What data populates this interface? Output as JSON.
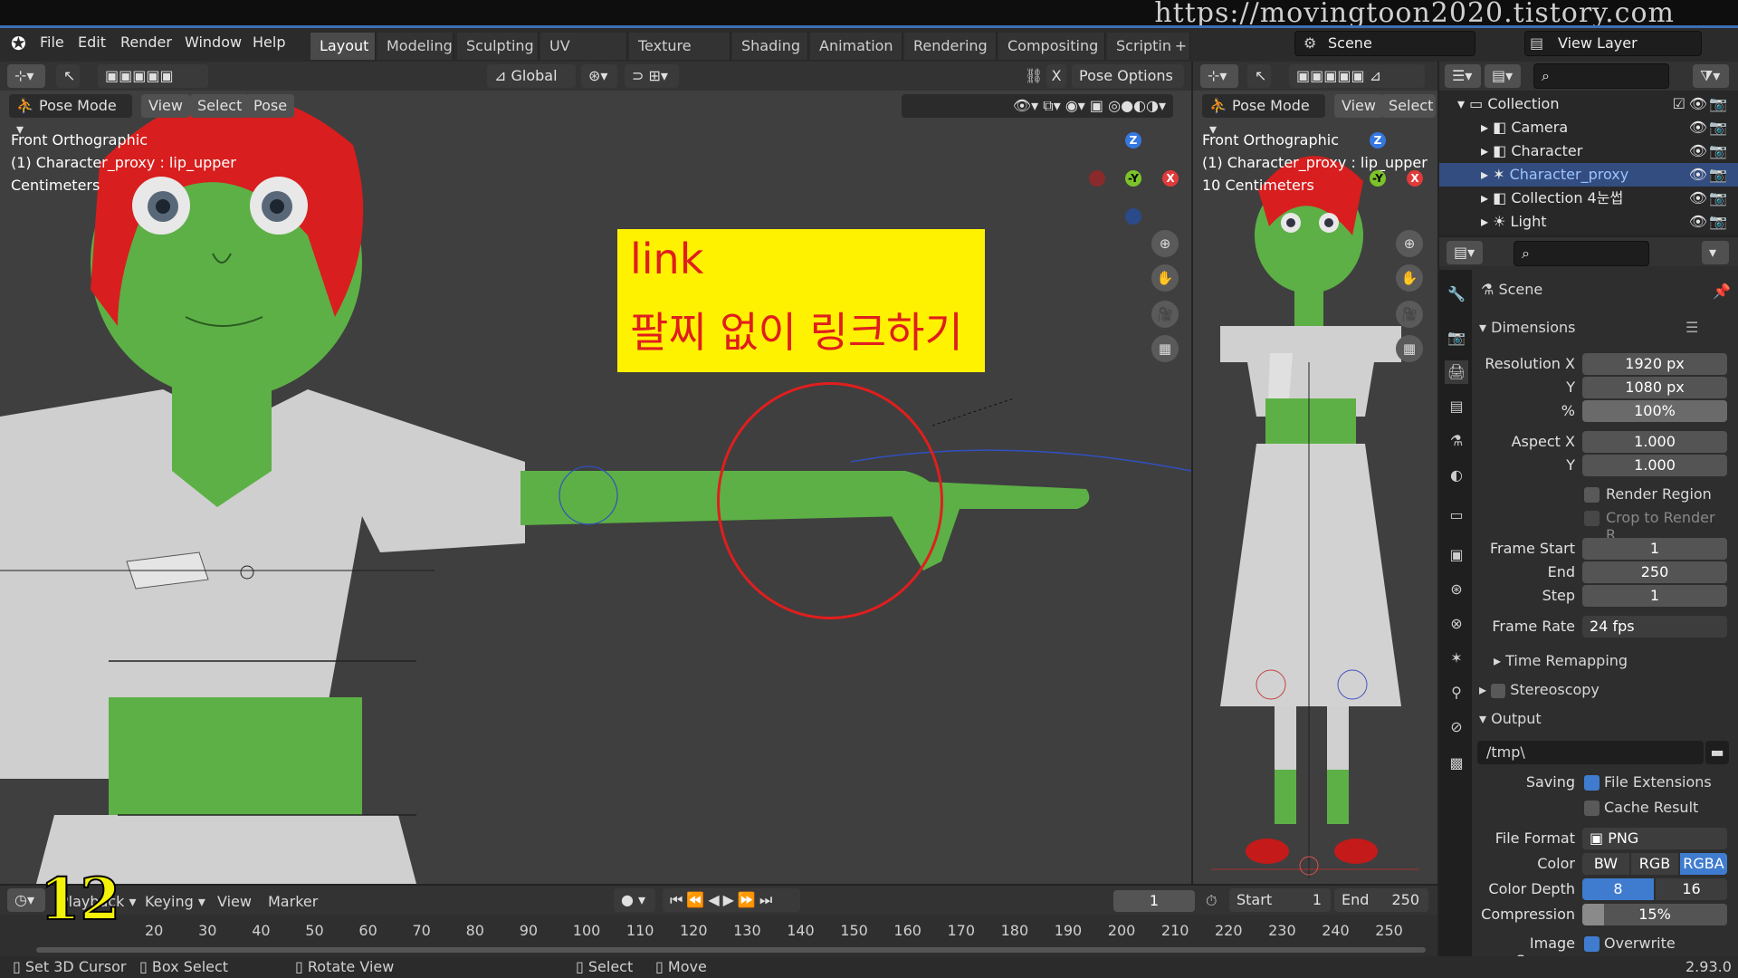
{
  "url_watermark": "https://movingtoon2020.tistory.com",
  "menus": [
    "File",
    "Edit",
    "Render",
    "Window",
    "Help"
  ],
  "workspaces": [
    "Layout",
    "Modeling",
    "Sculpting",
    "UV Editing",
    "Texture Paint",
    "Shading",
    "Animation",
    "Rendering",
    "Compositing",
    "Scripting"
  ],
  "active_workspace": "Layout",
  "scene_name": "Scene",
  "view_layer": "View Layer",
  "viewport_left": {
    "mode": "Pose Mode",
    "header_buttons": [
      "View",
      "Select",
      "Pose"
    ],
    "transform_orientation": "Global",
    "pose_options": "Pose Options",
    "overlay_lines": [
      "Front Orthographic",
      "(1) Character_proxy : lip_upper",
      "Centimeters"
    ]
  },
  "viewport_right": {
    "mode": "Pose Mode",
    "header_buttons": [
      "View",
      "Select"
    ],
    "overlay_lines": [
      "Front Orthographic",
      "(1) Character_proxy : lip_upper",
      "10 Centimeters"
    ]
  },
  "gizmo": {
    "z": "Z",
    "y": "-Y",
    "x": "X"
  },
  "annotation": {
    "line1": "link",
    "line2": "팔찌 없이 링크하기"
  },
  "outliner": {
    "root": "Collection",
    "items": [
      "Camera",
      "Character",
      "Character_proxy",
      "Collection 4눈썹",
      "Light"
    ],
    "selected": "Character_proxy"
  },
  "properties": {
    "context": "Scene",
    "dimensions_header": "Dimensions",
    "resolution_x_label": "Resolution X",
    "resolution_x": "1920 px",
    "resolution_y_label": "Y",
    "resolution_y": "1080 px",
    "percent_label": "%",
    "percent": "100%",
    "aspect_x_label": "Aspect X",
    "aspect_x": "1.000",
    "aspect_y_label": "Y",
    "aspect_y": "1.000",
    "render_region": "Render Region",
    "crop_region": "Crop to Render R...",
    "frame_start_label": "Frame Start",
    "frame_start": "1",
    "end_label": "End",
    "frame_end": "250",
    "step_label": "Step",
    "frame_step": "1",
    "frame_rate_label": "Frame Rate",
    "frame_rate": "24 fps",
    "time_remapping": "Time Remapping",
    "stereoscopy": "Stereoscopy",
    "output_header": "Output",
    "output_path": "/tmp\\",
    "saving_label": "Saving",
    "file_extensions": "File Extensions",
    "cache_result": "Cache Result",
    "file_format_label": "File Format",
    "file_format": "PNG",
    "color_label": "Color",
    "color_options": [
      "BW",
      "RGB",
      "RGBA"
    ],
    "color_selected": "RGBA",
    "color_depth_label": "Color Depth",
    "color_depth_options": [
      "8",
      "16"
    ],
    "color_depth_selected": "8",
    "compression_label": "Compression",
    "compression": "15%",
    "image_sequence_label": "Image Seque...",
    "overwrite": "Overwrite"
  },
  "timeline": {
    "menus": [
      "Playback",
      "Keying",
      "View",
      "Marker"
    ],
    "current_frame": "1",
    "start_label": "Start",
    "start": "1",
    "end_label": "End",
    "end": "250",
    "ruler": [
      "20",
      "30",
      "40",
      "50",
      "60",
      "70",
      "80",
      "90",
      "100",
      "110",
      "120",
      "130",
      "140",
      "150",
      "160",
      "170",
      "180",
      "190",
      "200",
      "210",
      "220",
      "230",
      "240",
      "250"
    ]
  },
  "episode_number": "12",
  "status": {
    "items": [
      "Set 3D Cursor",
      "Box Select",
      "Rotate View",
      "Select",
      "Move"
    ],
    "version": "2.93.0"
  }
}
